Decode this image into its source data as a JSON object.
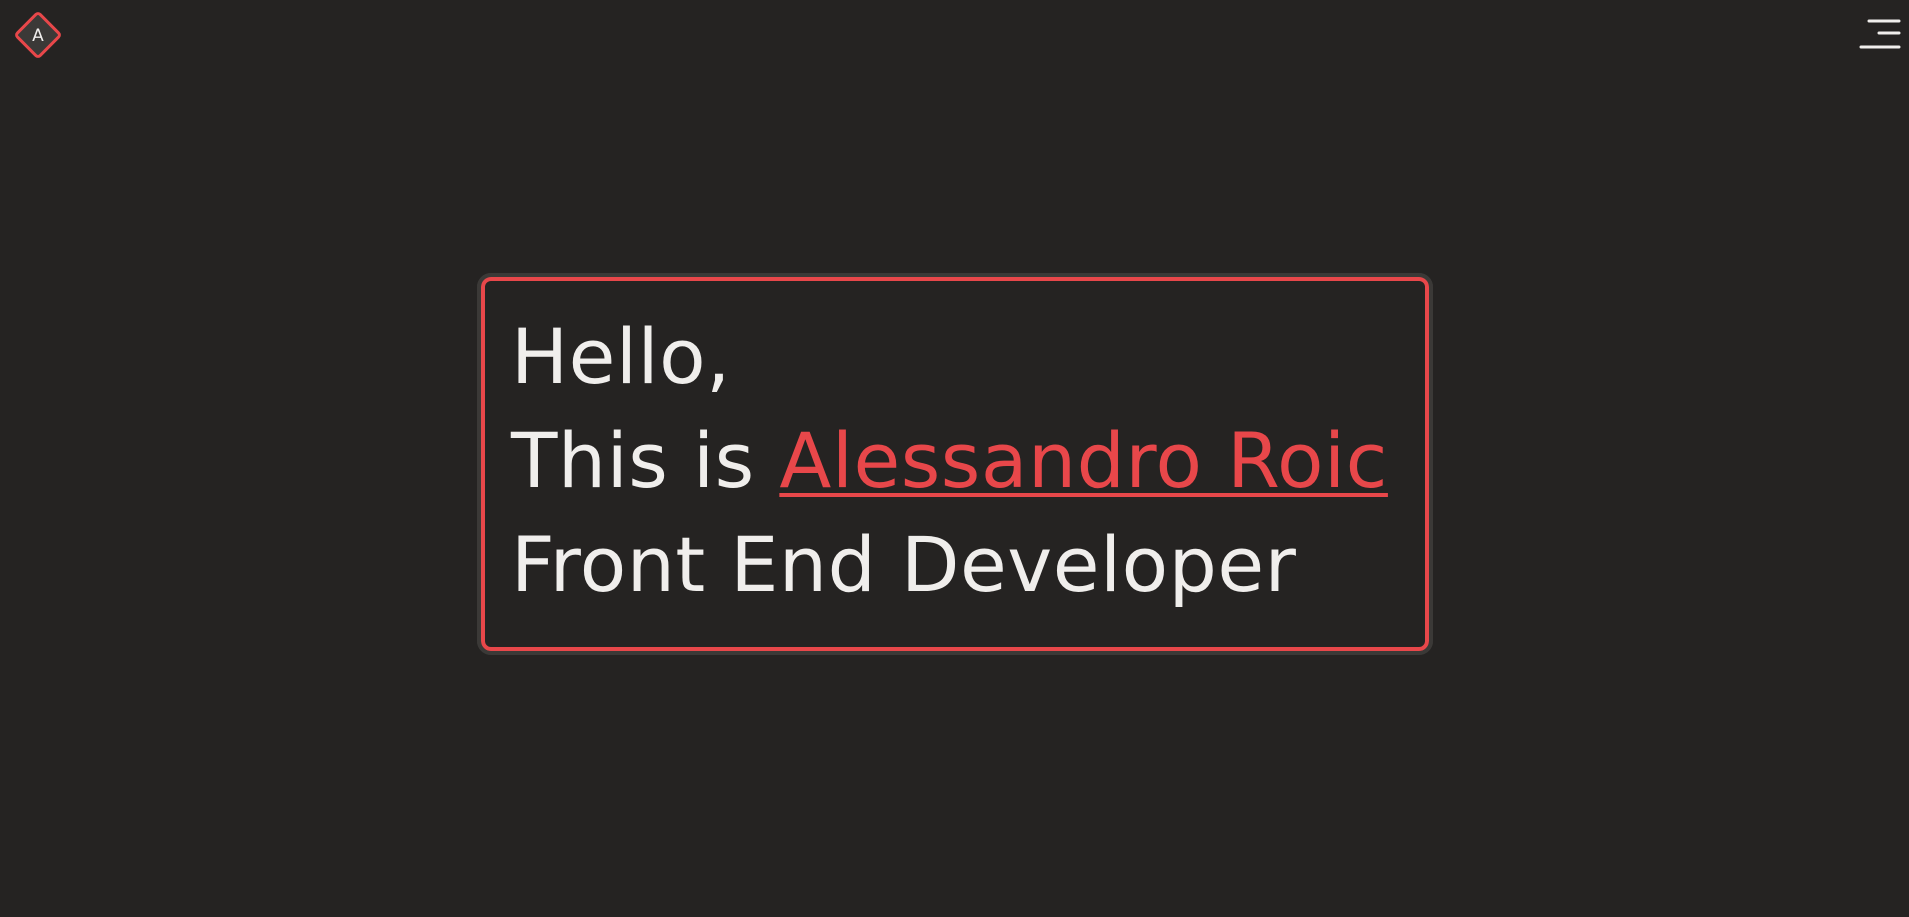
{
  "header": {
    "logo": {
      "letter": "A",
      "icon": "diamond-logo-icon"
    },
    "menu": {
      "icon": "hamburger-menu-icon"
    }
  },
  "hero": {
    "greeting": "Hello,",
    "intro_prefix": "This is ",
    "name": "Alessandro Roic",
    "role": "Front End Developer"
  },
  "colors": {
    "background": "#252322",
    "accent": "#e8474a",
    "text": "#f0eeec",
    "card_outline": "#3b3937"
  }
}
